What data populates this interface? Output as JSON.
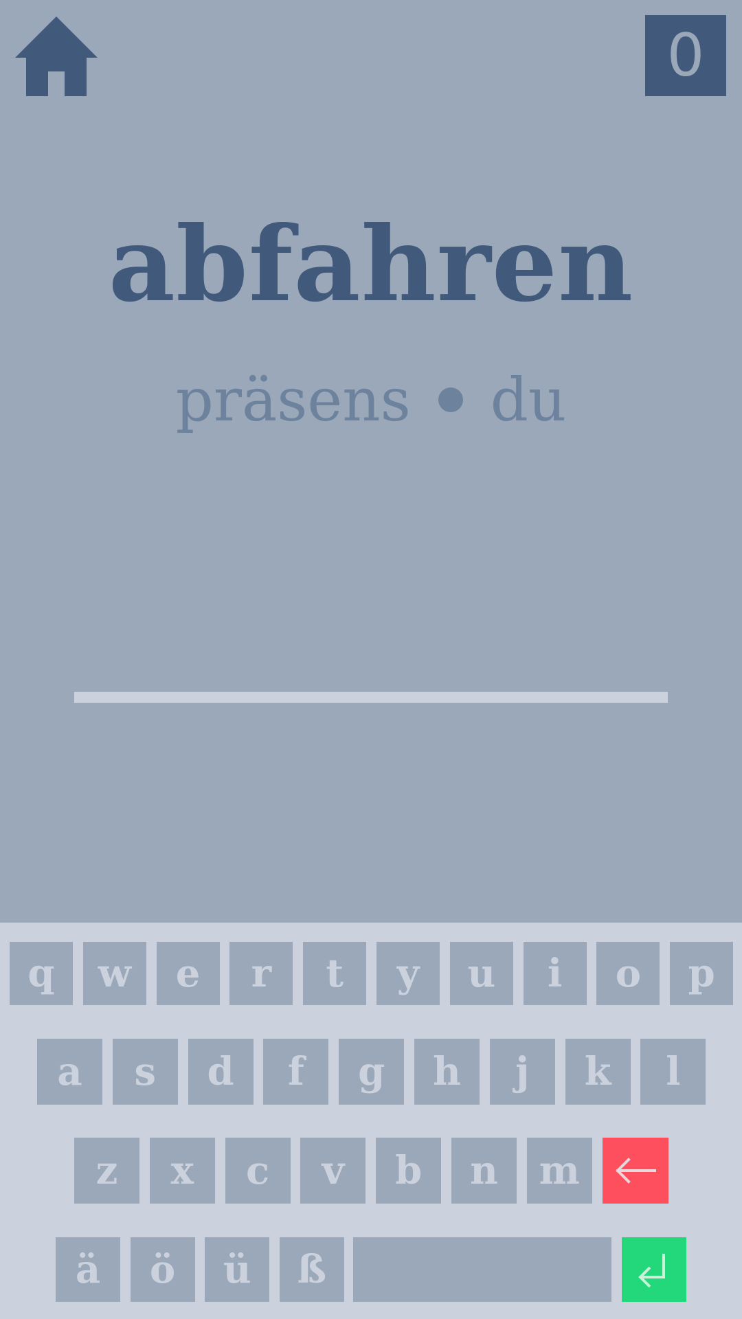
{
  "header": {
    "home_icon": "home-icon",
    "score": "0"
  },
  "prompt": {
    "verb": "abfahren",
    "tense": "präsens",
    "separator_icon": "bullet-dot",
    "person": "du"
  },
  "answer": {
    "value": "",
    "placeholder": ""
  },
  "keyboard": {
    "row1": [
      "q",
      "w",
      "e",
      "r",
      "t",
      "y",
      "u",
      "i",
      "o",
      "p"
    ],
    "row2": [
      "a",
      "s",
      "d",
      "f",
      "g",
      "h",
      "j",
      "k",
      "l"
    ],
    "row3": [
      "z",
      "x",
      "c",
      "v",
      "b",
      "n",
      "m"
    ],
    "row4": [
      "ä",
      "ö",
      "ü",
      "ß"
    ],
    "backspace_icon": "arrow-left-icon",
    "enter_icon": "enter-return-icon",
    "space_label": ""
  },
  "colors": {
    "background": "#9aa8b9",
    "accent": "#41597a",
    "subtle_text": "#6d829c",
    "keyboard_bg": "#cbd2dd",
    "backspace": "#fd4f5d",
    "enter": "#22d87a"
  }
}
